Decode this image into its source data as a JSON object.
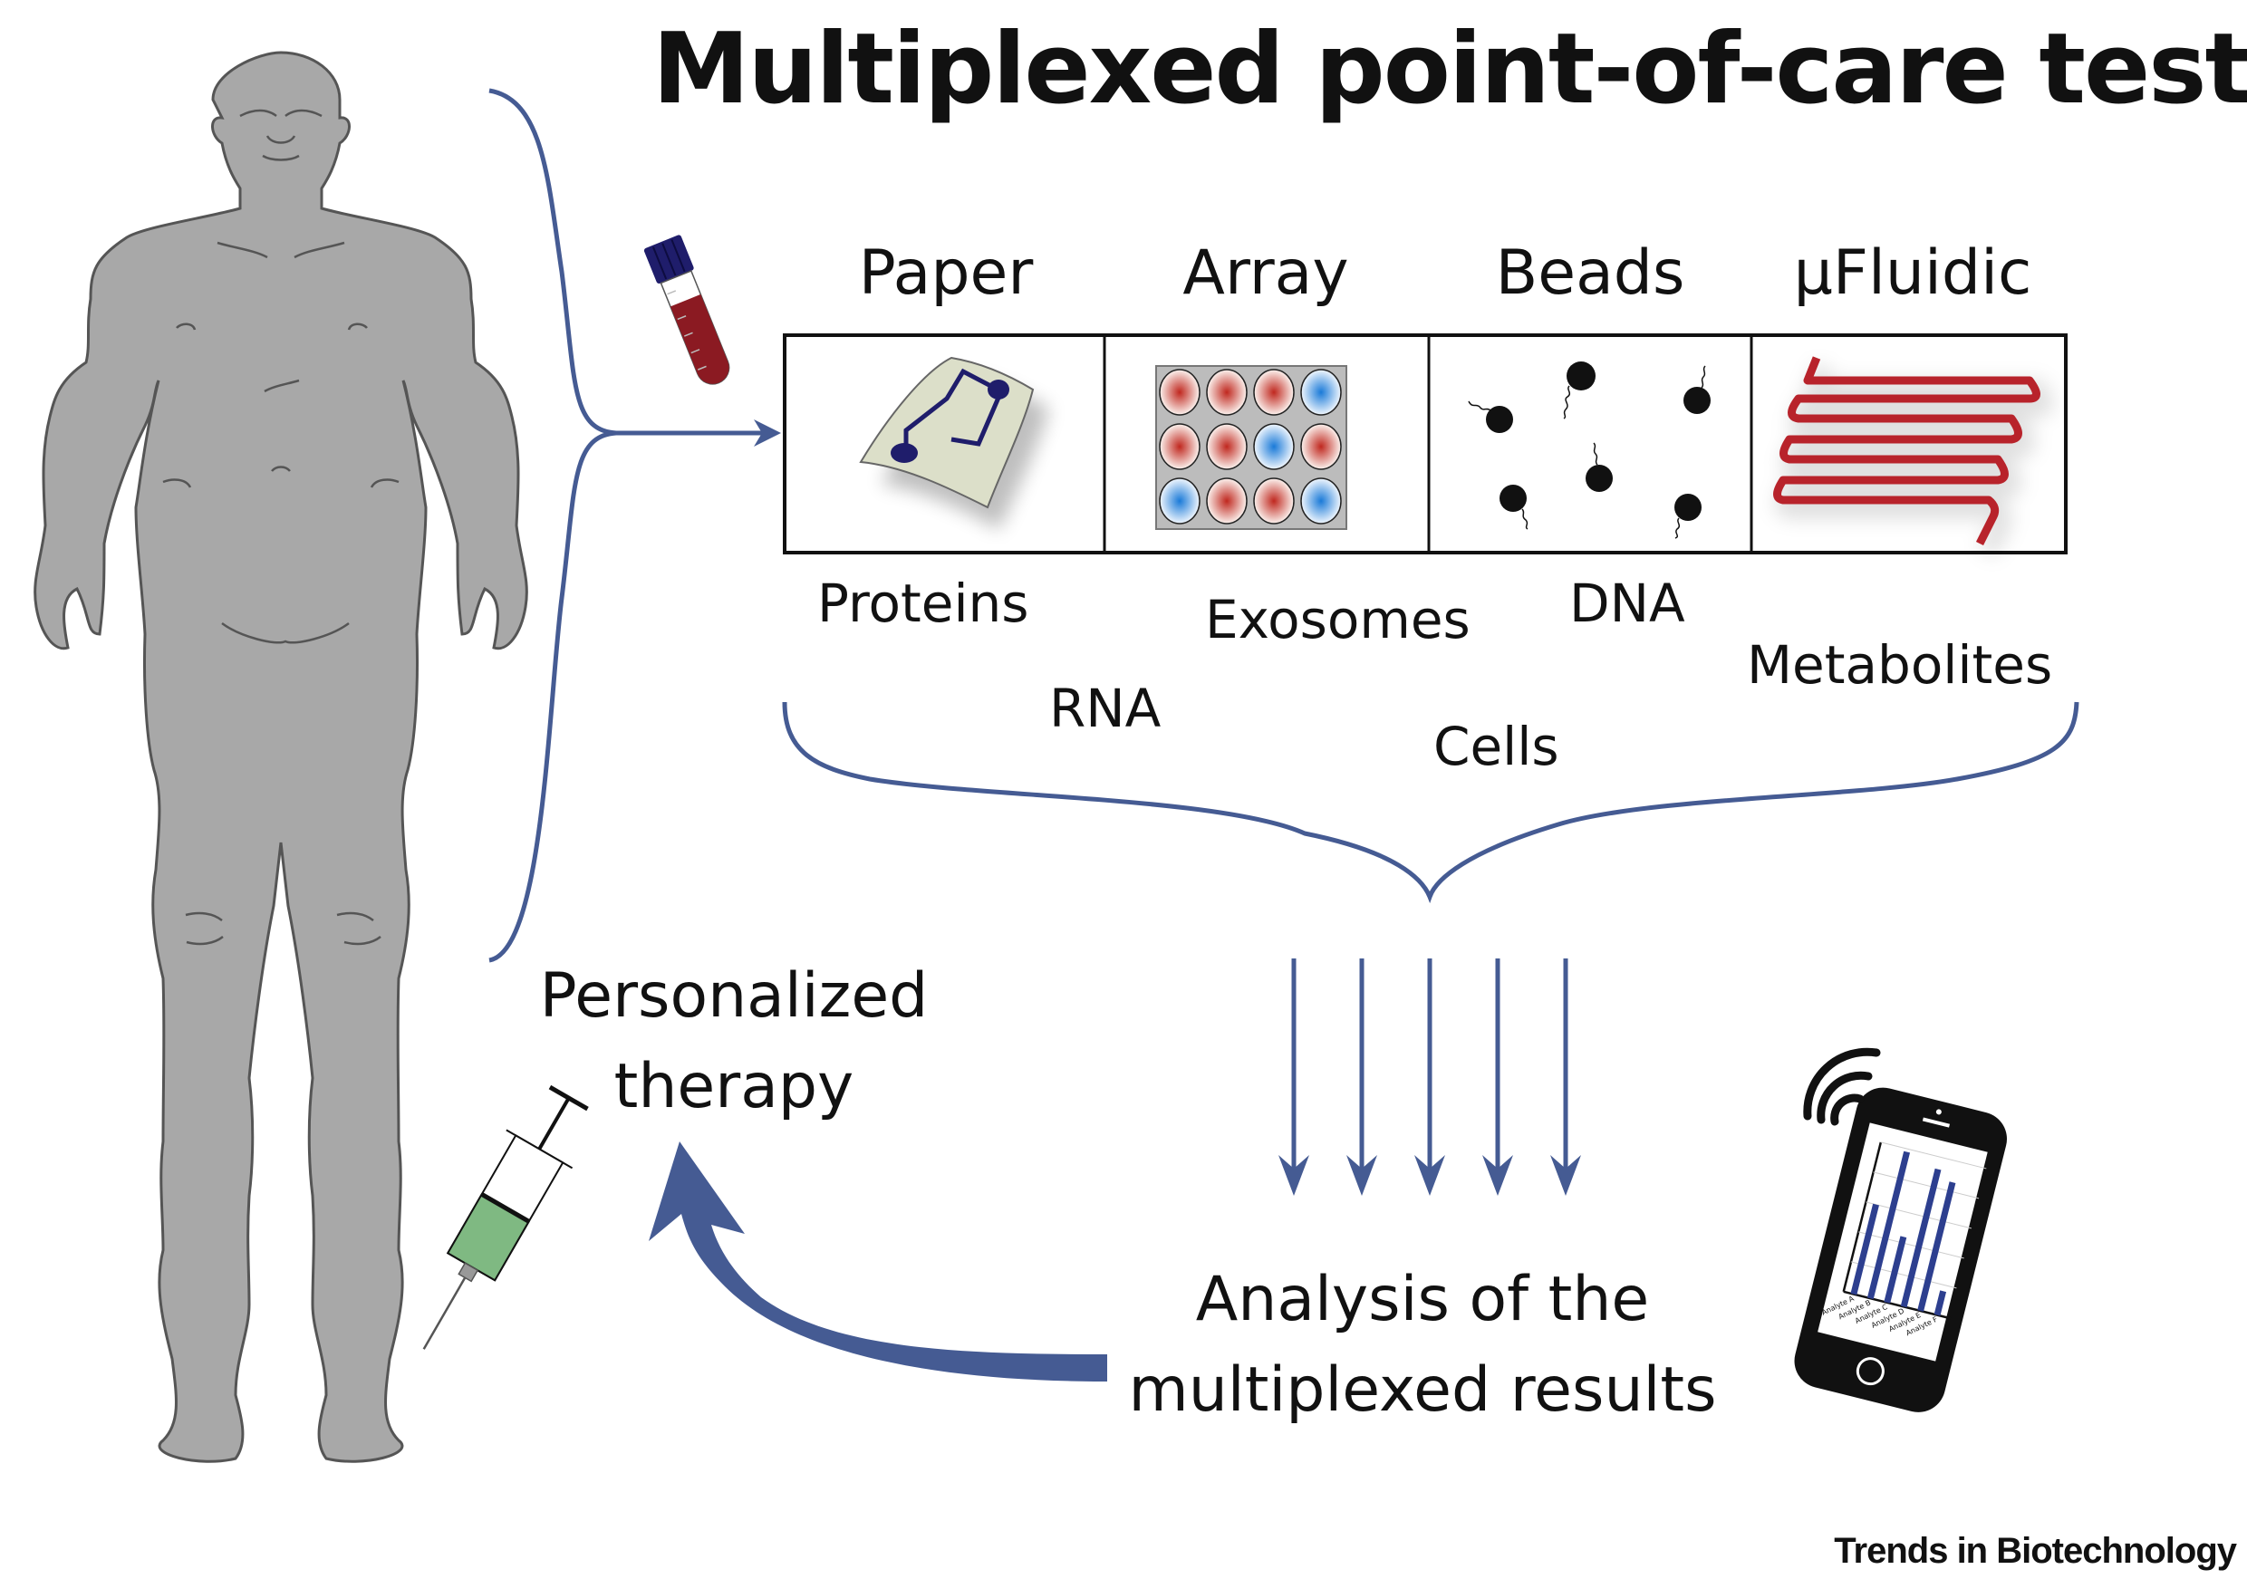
{
  "title": "Multiplexed point-of-care testing",
  "platforms": [
    {
      "label": "Paper",
      "icon": "paper-device-icon"
    },
    {
      "label": "Array",
      "icon": "well-array-icon"
    },
    {
      "label": "Beads",
      "icon": "beads-icon"
    },
    {
      "label": "μFluidic",
      "icon": "microfluidic-channel-icon"
    }
  ],
  "array_wells": [
    [
      "red",
      "red",
      "red",
      "blue"
    ],
    [
      "red",
      "red",
      "blue",
      "red"
    ],
    [
      "blue",
      "red",
      "red",
      "blue"
    ]
  ],
  "analytes": [
    "Proteins",
    "RNA",
    "Exosomes",
    "Cells",
    "DNA",
    "Metabolites"
  ],
  "therapy": {
    "line1": "Personalized",
    "line2": "therapy"
  },
  "analysis": {
    "line1": "Analysis of the",
    "line2": "multiplexed results"
  },
  "phone_chart": {
    "type": "bar",
    "categories": [
      "Analyte A",
      "Analyte B",
      "Analyte C",
      "Analyte D",
      "Analyte E",
      "Analyte F"
    ],
    "values": [
      3.0,
      4.9,
      2.2,
      4.6,
      4.3,
      0.8
    ]
  },
  "colors": {
    "accent_blue": "#455b93",
    "human_gray": "#a8a8a8",
    "blood_red": "#8b1a22",
    "tube_cap": "#1f1d6b",
    "channel_red": "#b8232b",
    "syringe_green": "#7fb982",
    "paper_fill": "#dcdfc9"
  },
  "credit": "Trends in Biotechnology"
}
